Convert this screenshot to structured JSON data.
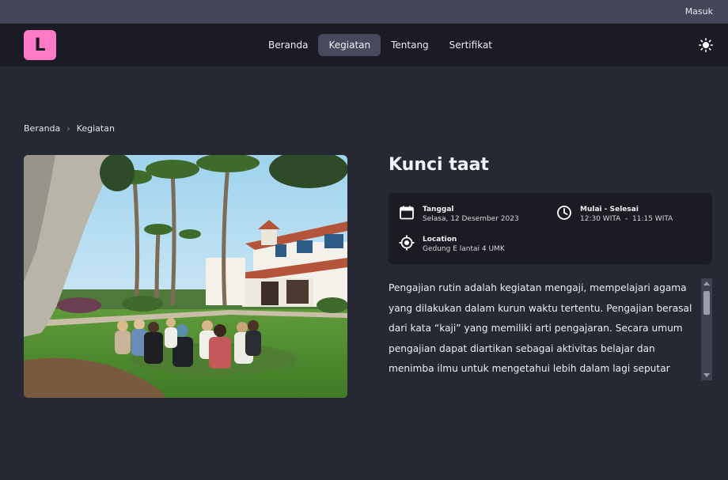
{
  "topbar": {
    "login_label": "Masuk"
  },
  "navbar": {
    "logo_letter": "L",
    "items": [
      {
        "label": "Beranda",
        "active": false
      },
      {
        "label": "Kegiatan",
        "active": true
      },
      {
        "label": "Tentang",
        "active": false
      },
      {
        "label": "Sertifikat",
        "active": false
      }
    ],
    "theme_icon": "sun-icon"
  },
  "breadcrumb": {
    "items": [
      "Beranda",
      "Kegiatan"
    ]
  },
  "event": {
    "title": "Kunci taat",
    "date_label": "Tanggal",
    "date_value": "Selasa, 12 Desember 2023",
    "time_label": "Mulai - Selesai",
    "time_value": "12:30 WITA  -  11:15 WITA",
    "location_label": "Location",
    "location_value": "Gedung E lantai 4 UMK",
    "description": "Pengajian rutin adalah kegiatan mengaji, mempelajari agama yang dilakukan dalam kurun waktu tertentu. Pengajian berasal dari kata “kaji” yang memiliki arti pengajaran. Secara umum pengajian dapat diartikan sebagai aktivitas belajar dan menimba ilmu untuk mengetahui lebih dalam lagi seputar ajaran agama Islam. Sebagai"
  },
  "colors": {
    "background": "#262833",
    "navbar": "#1a1b24",
    "topbar": "#444759",
    "logo": "#ff79c6",
    "active_nav": "#464a5c",
    "card": "#1a1b23"
  }
}
